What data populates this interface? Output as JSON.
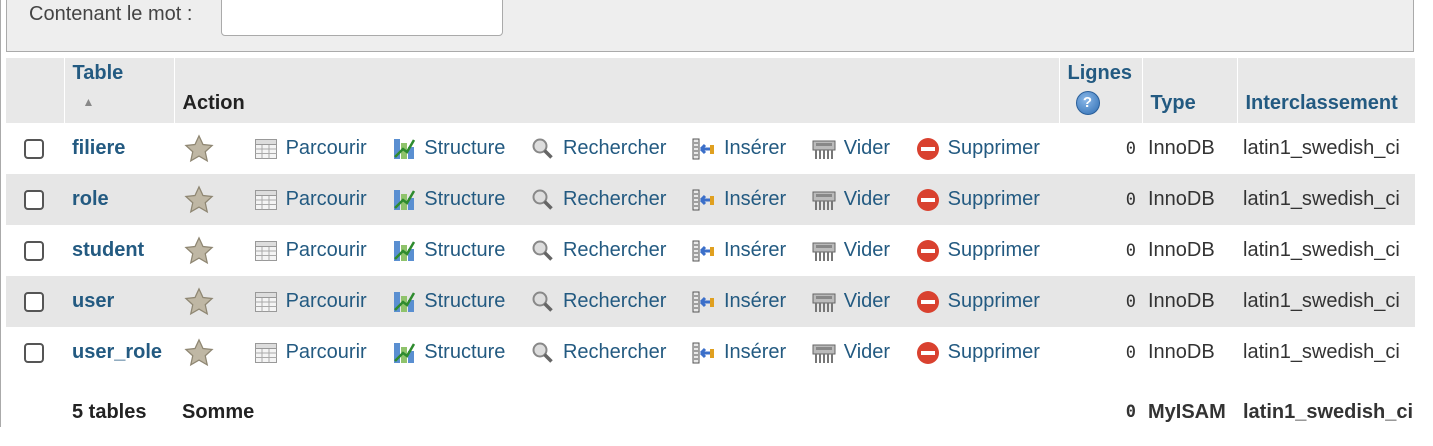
{
  "filter": {
    "label": "Contenant le mot :",
    "value": ""
  },
  "headers": {
    "table": "Table",
    "action": "Action",
    "rows": "Lignes",
    "type": "Type",
    "collation": "Interclassement"
  },
  "actions": {
    "browse": "Parcourir",
    "structure": "Structure",
    "search": "Rechercher",
    "insert": "Insérer",
    "empty": "Vider",
    "drop": "Supprimer"
  },
  "tables": [
    {
      "name": "filiere",
      "rows": "0",
      "type": "InnoDB",
      "collation": "latin1_swedish_ci"
    },
    {
      "name": "role",
      "rows": "0",
      "type": "InnoDB",
      "collation": "latin1_swedish_ci"
    },
    {
      "name": "student",
      "rows": "0",
      "type": "InnoDB",
      "collation": "latin1_swedish_ci"
    },
    {
      "name": "user",
      "rows": "0",
      "type": "InnoDB",
      "collation": "latin1_swedish_ci"
    },
    {
      "name": "user_role",
      "rows": "0",
      "type": "InnoDB",
      "collation": "latin1_swedish_ci"
    }
  ],
  "footer": {
    "count": "5 tables",
    "sum": "Somme",
    "rows": "0",
    "type": "MyISAM",
    "collation": "latin1_swedish_ci"
  },
  "colors": {
    "link": "#235a81",
    "header_bg": "#e8e8e8",
    "row_alt_bg": "#e6e6e6"
  }
}
